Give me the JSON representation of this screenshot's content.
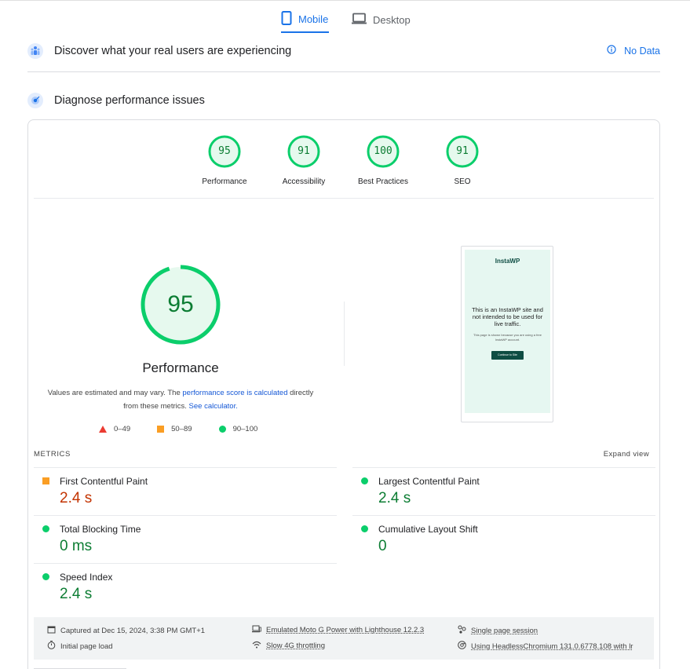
{
  "tabs": [
    {
      "label": "Mobile",
      "icon": "phone-icon",
      "active": true
    },
    {
      "label": "Desktop",
      "icon": "laptop-icon",
      "active": false
    }
  ],
  "field_data": {
    "title": "Discover what your real users are experiencing",
    "status": "No Data"
  },
  "diagnose": {
    "title": "Diagnose performance issues"
  },
  "categories": [
    {
      "score": "95",
      "label": "Performance"
    },
    {
      "score": "91",
      "label": "Accessibility"
    },
    {
      "score": "100",
      "label": "Best Practices"
    },
    {
      "score": "91",
      "label": "SEO"
    }
  ],
  "performance": {
    "score": "95",
    "score_fraction": 0.95,
    "title": "Performance",
    "note_prefix": "Values are estimated and may vary. The ",
    "note_link": "performance score is calculated",
    "note_middle": " directly from these metrics. ",
    "note_link2": "See calculator.",
    "legend": [
      "0–49",
      "50–89",
      "90–100"
    ]
  },
  "screenshot": {
    "logo": "InstaWP",
    "message": "This is an InstaWP site and not intended to be used for live traffic.",
    "small_text": "This page is shown because you are using a free InstaWP account.",
    "button": "Continue to Site"
  },
  "metrics": {
    "header": "METRICS",
    "expand": "Expand view",
    "items": [
      {
        "name": "First Contentful Paint",
        "value": "2.4 s",
        "rating": "average"
      },
      {
        "name": "Largest Contentful Paint",
        "value": "2.4 s",
        "rating": "pass"
      },
      {
        "name": "Total Blocking Time",
        "value": "0 ms",
        "rating": "pass"
      },
      {
        "name": "Cumulative Layout Shift",
        "value": "0",
        "rating": "pass"
      },
      {
        "name": "Speed Index",
        "value": "2.4 s",
        "rating": "pass"
      }
    ]
  },
  "footer": {
    "captured": "Captured at Dec 15, 2024, 3:38 PM GMT+1",
    "initial": "Initial page load",
    "device": "Emulated Moto G Power with Lighthouse 12.2.3",
    "throttling": "Slow 4G throttling",
    "session": "Single page session",
    "browser": "Using HeadlessChromium 131.0.6778.108 with lr"
  },
  "colors": {
    "accent": "#1a73e8",
    "pass": "#0cce6b",
    "pass_text": "#0c7d33",
    "average": "#ffa400",
    "average_text": "#c33300",
    "fail": "#ff4e42"
  }
}
